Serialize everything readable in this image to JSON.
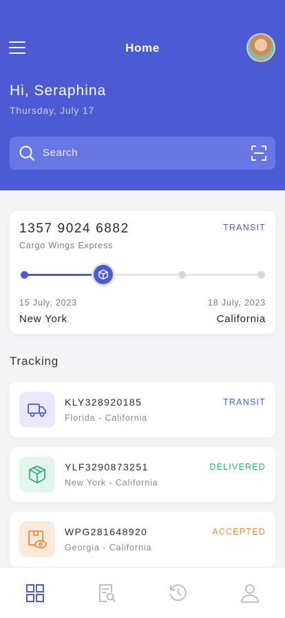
{
  "header": {
    "title": "Home",
    "greeting": "Hi, Seraphina",
    "date": "Thursday, July 17",
    "search_placeholder": "Search"
  },
  "featured": {
    "tracking_number": "1357 9024 6882",
    "carrier": "Cargo Wings Express",
    "status": "TRANSIT",
    "progress_stage": 2,
    "progress_total": 4,
    "from_date": "15 July, 2023",
    "to_date": "18 July, 2023",
    "from_city": "New York",
    "to_city": "California"
  },
  "tracking": {
    "title": "Tracking",
    "items": [
      {
        "number": "KLY328920185",
        "route": "Florida - California",
        "status": "TRANSIT",
        "icon": "truck-icon"
      },
      {
        "number": "YLF3290873251",
        "route": "New York - California",
        "status": "DELIVERED",
        "icon": "box-icon"
      },
      {
        "number": "WPG281648920",
        "route": "Georgia - California",
        "status": "ACCEPTED",
        "icon": "package-view-icon"
      }
    ]
  },
  "nav": [
    "home-nav-icon",
    "search-document-nav-icon",
    "history-nav-icon",
    "profile-nav-icon"
  ],
  "colors": {
    "primary": "#4c5bd4",
    "transit": "#4c5bd4",
    "delivered": "#2fae78",
    "accepted": "#ee8a3a"
  }
}
